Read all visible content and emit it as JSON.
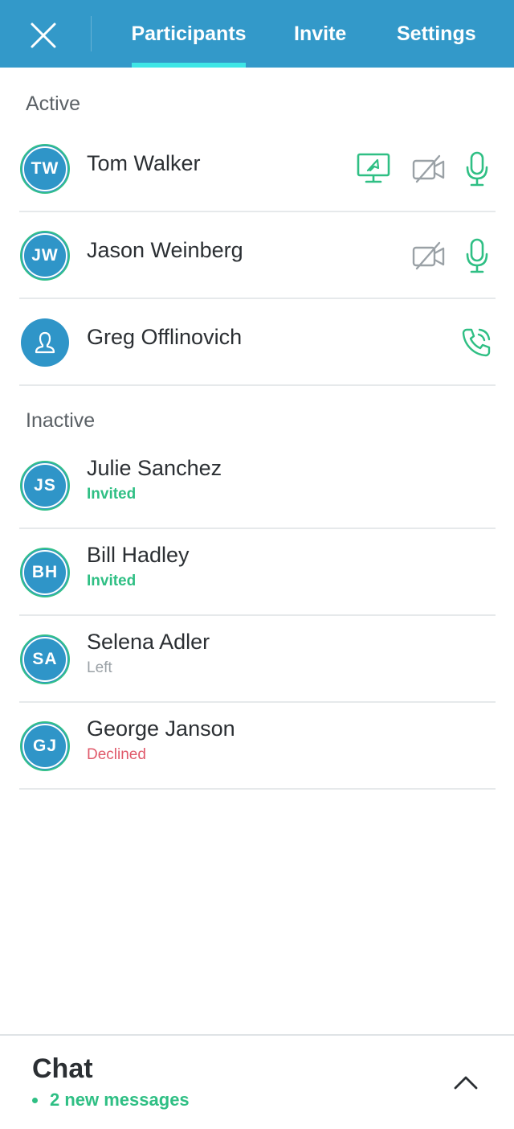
{
  "header": {
    "tabs": [
      {
        "label": "Participants",
        "active": true
      },
      {
        "label": "Invite",
        "active": false
      },
      {
        "label": "Settings",
        "active": false
      }
    ],
    "close_icon": "close-icon"
  },
  "sections": {
    "active_title": "Active",
    "inactive_title": "Inactive"
  },
  "active": [
    {
      "initials": "TW",
      "name": "Tom Walker",
      "icons": [
        "screen-share-icon",
        "video-off-icon",
        "microphone-icon"
      ]
    },
    {
      "initials": "JW",
      "name": "Jason Weinberg",
      "icons": [
        "video-off-icon",
        "microphone-icon"
      ]
    },
    {
      "initials": "",
      "name": "Greg Offlinovich",
      "icons": [
        "phone-call-icon"
      ],
      "avatar_icon": "person-icon"
    }
  ],
  "inactive": [
    {
      "initials": "JS",
      "name": "Julie Sanchez",
      "status": "Invited"
    },
    {
      "initials": "BH",
      "name": "Bill Hadley",
      "status": "Invited"
    },
    {
      "initials": "SA",
      "name": "Selena Adler",
      "status": "Left"
    },
    {
      "initials": "GJ",
      "name": "George Janson",
      "status": "Declined"
    }
  ],
  "chat": {
    "title": "Chat",
    "subtitle": "2 new messages",
    "toggle_icon": "chevron-up-icon"
  },
  "colors": {
    "header": "#3399c9",
    "accent_underline": "#3ee6e6",
    "avatar": "#2f95c8",
    "green": "#2fbf84",
    "gray_icon": "#9aa1a6",
    "declined": "#e05a6b"
  }
}
